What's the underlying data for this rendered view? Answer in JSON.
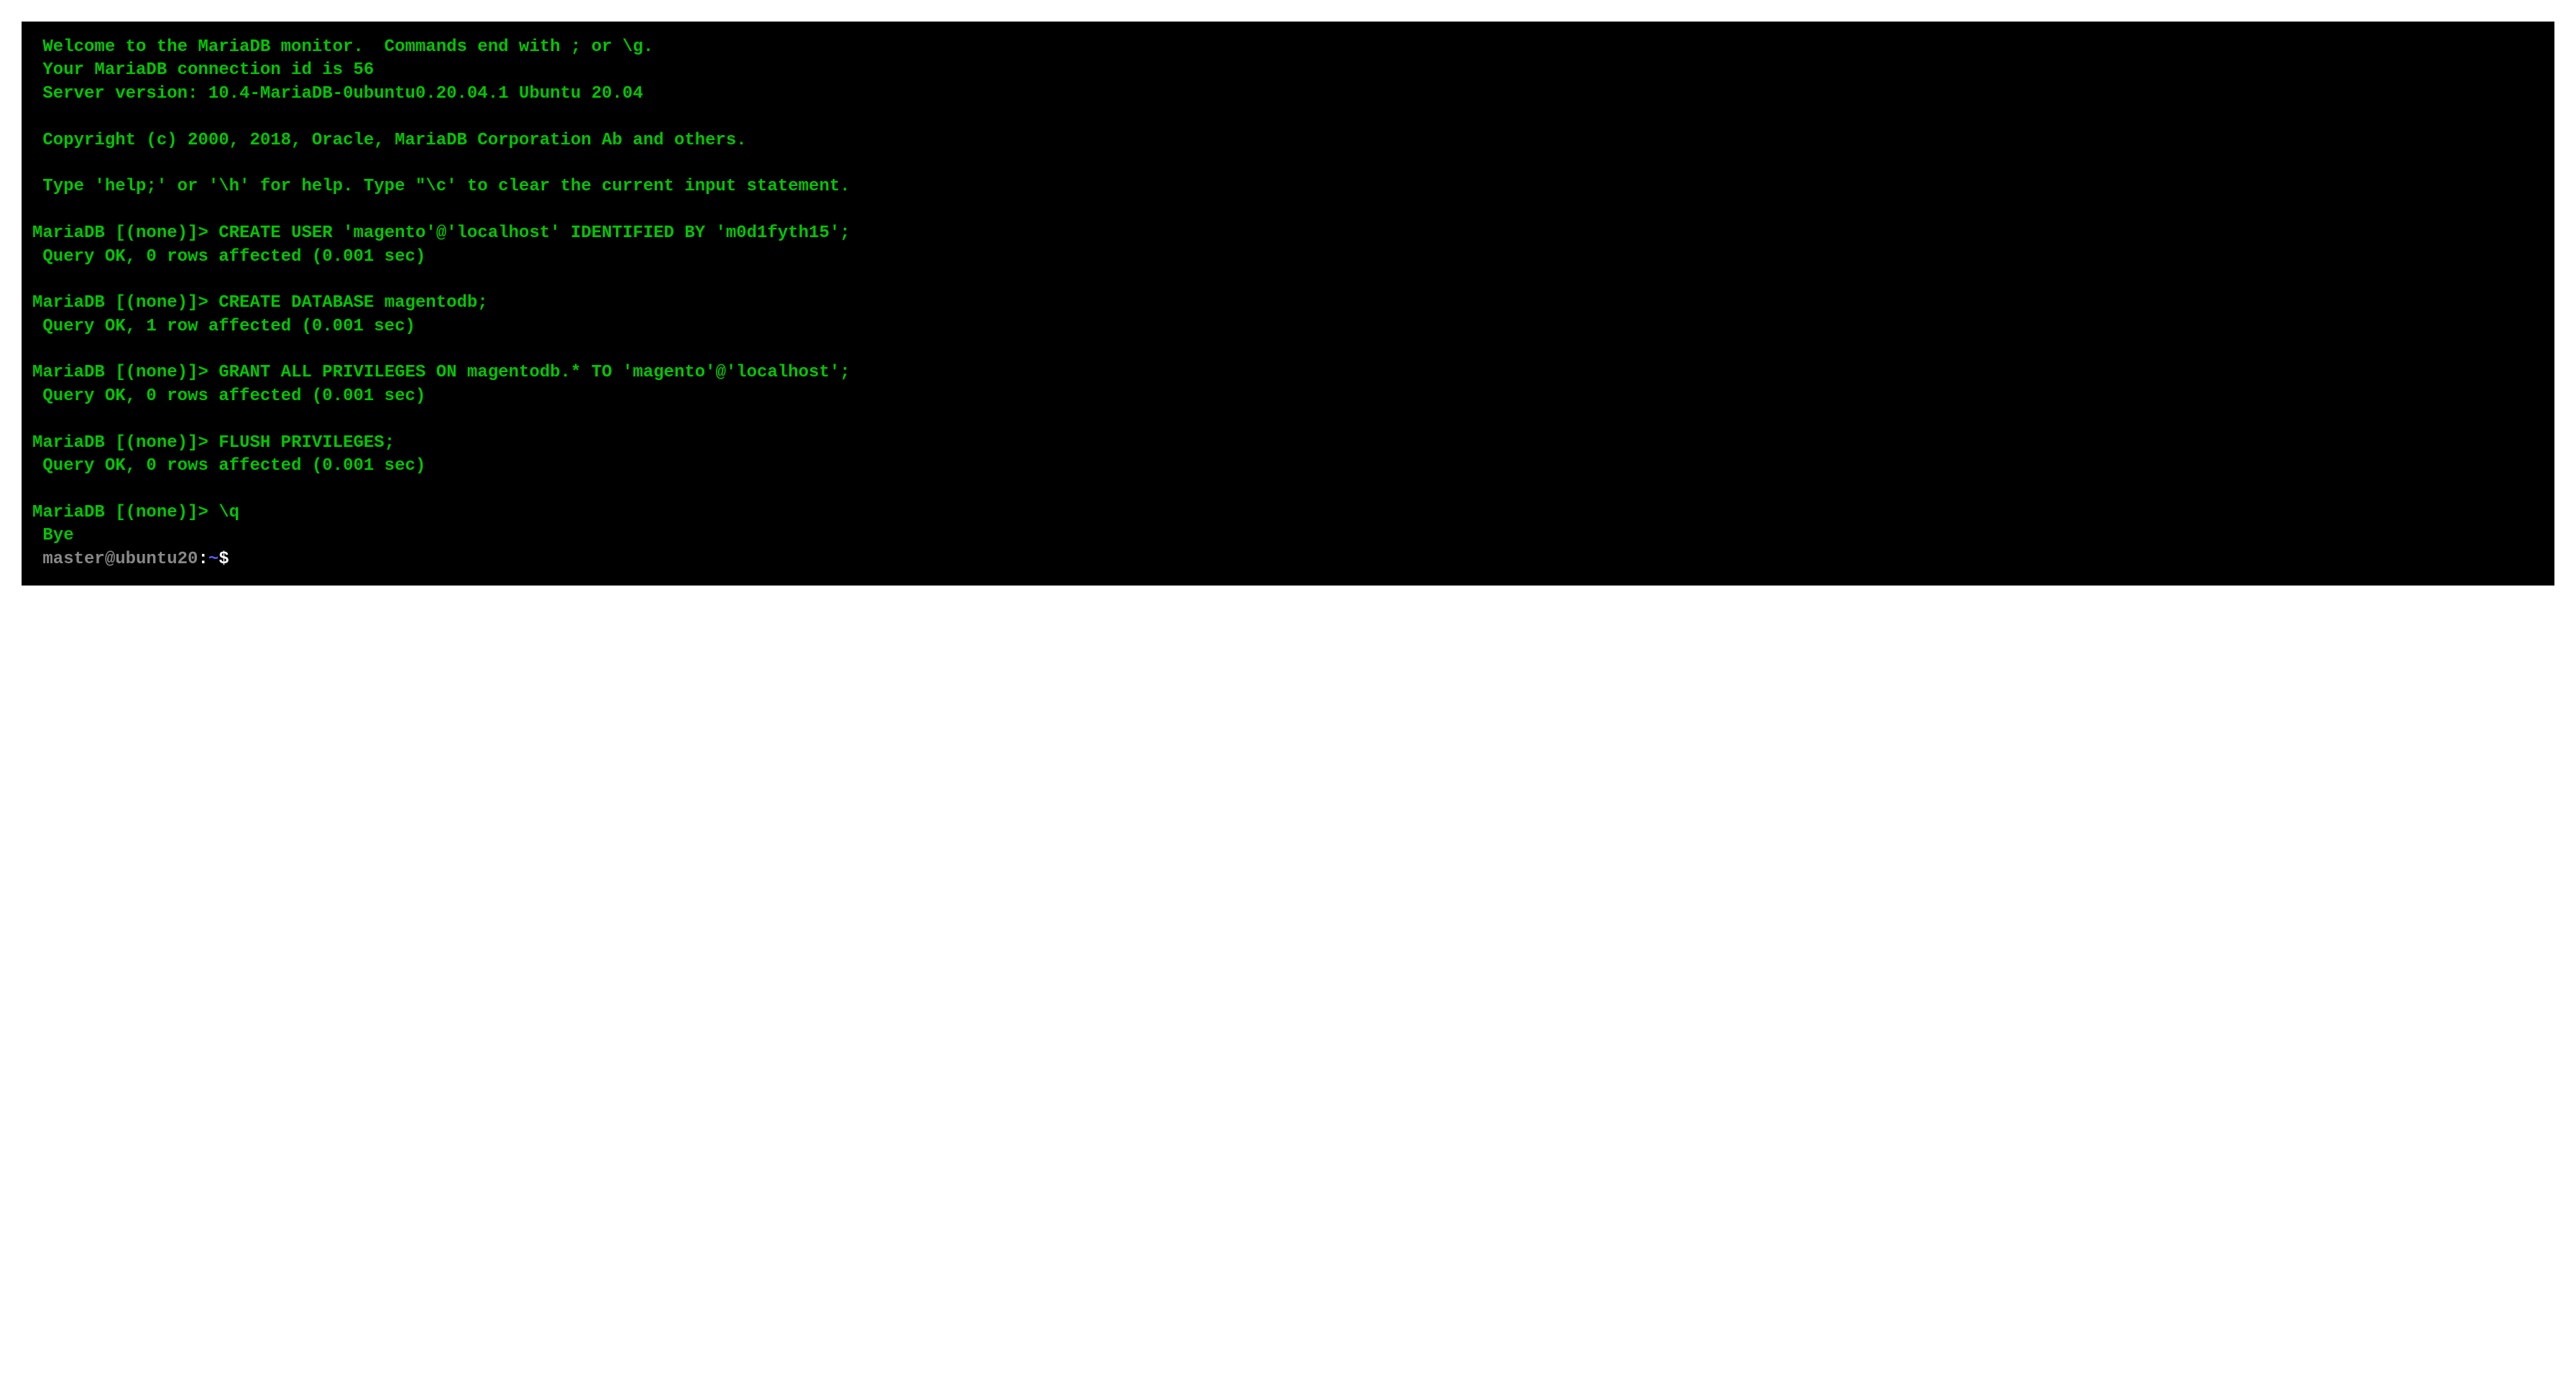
{
  "banner": {
    "welcome": " Welcome to the MariaDB monitor.  Commands end with ; or \\g.",
    "connection": " Your MariaDB connection id is 56",
    "version": " Server version: 10.4-MariaDB-0ubuntu0.20.04.1 Ubuntu 20.04",
    "copyright": " Copyright (c) 2000, 2018, Oracle, MariaDB Corporation Ab and others.",
    "help": " Type 'help;' or '\\h' for help. Type \"\\c' to clear the current input statement."
  },
  "entries": [
    {
      "prompt": "MariaDB [(none)]> ",
      "cmd": "CREATE USER 'magento'@'localhost' IDENTIFIED BY 'm0d1fyth15';",
      "result": " Query OK, 0 rows affected (0.001 sec)"
    },
    {
      "prompt": "MariaDB [(none)]> ",
      "cmd": "CREATE DATABASE magentodb;",
      "result": " Query OK, 1 row affected (0.001 sec)"
    },
    {
      "prompt": "MariaDB [(none)]> ",
      "cmd": "GRANT ALL PRIVILEGES ON magentodb.* TO 'magento'@'localhost';",
      "result": " Query OK, 0 rows affected (0.001 sec)"
    },
    {
      "prompt": "MariaDB [(none)]> ",
      "cmd": "FLUSH PRIVILEGES;",
      "result": " Query OK, 0 rows affected (0.001 sec)"
    }
  ],
  "quit": {
    "prompt": "MariaDB [(none)]> ",
    "cmd": "\\q",
    "bye": " Bye"
  },
  "shell": {
    "user": " master@ubuntu20",
    "colon": ":",
    "path": "~",
    "dollar": "$"
  }
}
